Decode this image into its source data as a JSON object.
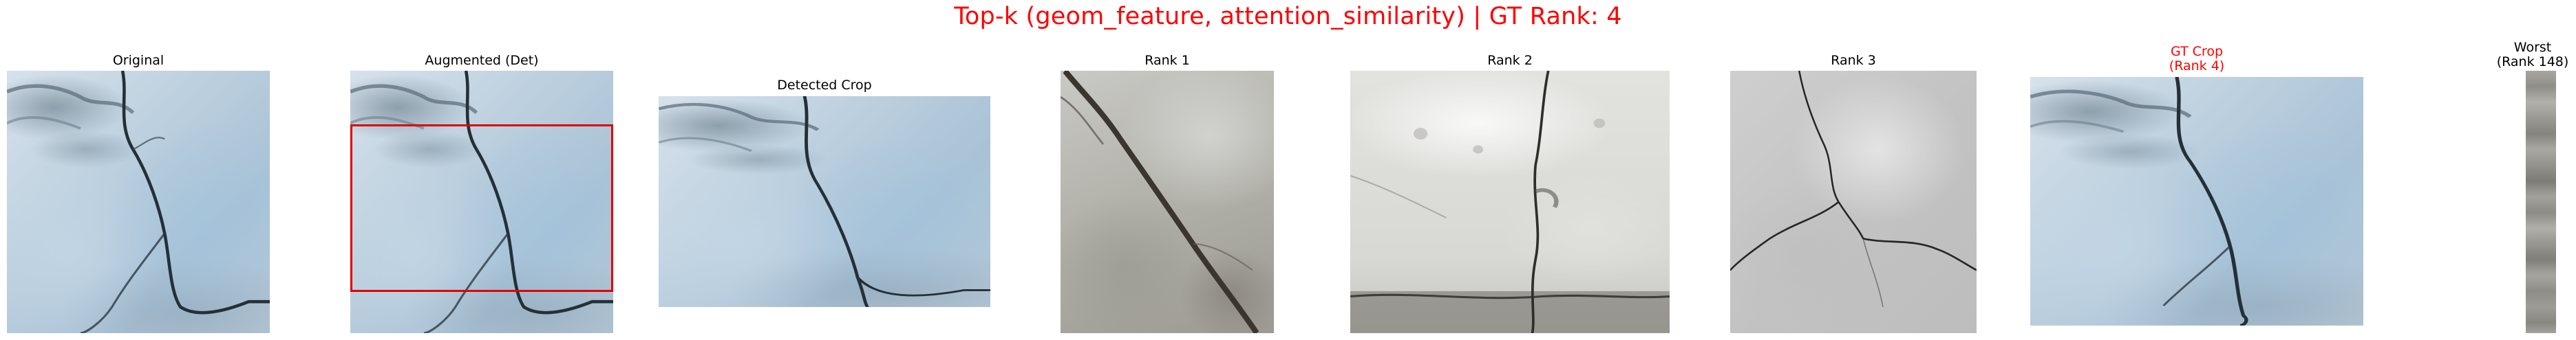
{
  "figure": {
    "title": "Top-k (geom_feature, attention_similarity) | GT Rank: 4",
    "title_color": "#ff0000"
  },
  "panels": [
    {
      "label": "Original",
      "image": "cracked-concrete-photo"
    },
    {
      "label": "Augmented (Det)",
      "image": "augmented-concrete-photo",
      "box_color": "#e00000"
    },
    {
      "label": "Detected Crop",
      "image": "detected-crop-photo"
    },
    {
      "label": "Rank 1",
      "image": "retrieved-concrete-photo"
    },
    {
      "label": "Rank 2",
      "image": "retrieved-painted-wall-photo"
    },
    {
      "label": "Rank 3",
      "image": "retrieved-plaster-wall-photo"
    },
    {
      "label_line1": "GT Crop",
      "label_line2": "(Rank 4)",
      "color": "#ff0000",
      "image": "ground-truth-crop-photo"
    },
    {
      "label_line1": "Worst",
      "label_line2": "(Rank 148)",
      "image": "worst-match-strip"
    }
  ]
}
